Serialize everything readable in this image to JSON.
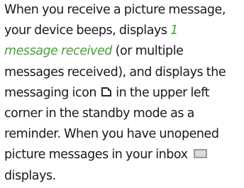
{
  "paragraph": {
    "l1": "When you receive a picture message,",
    "l2_a": "your device beeps, displays ",
    "l2_em": "1",
    "l3_em": "message received",
    "l3_b": " (or multiple",
    "l4": "messages received), and displays the",
    "l5_a": "messaging icon ",
    "l5_b": " in the upper left",
    "l6": "corner in the standby mode as a",
    "l7": "reminder. When you have unopened",
    "l8_a": "picture messages in your inbox ",
    "l9": "displays."
  },
  "icons": {
    "messaging_icon": "messaging-icon",
    "unopened_picture_icon": "unopened-picture-message-icon"
  },
  "colors": {
    "text": "#1a1a1a",
    "emphasis": "#4aa03a"
  }
}
